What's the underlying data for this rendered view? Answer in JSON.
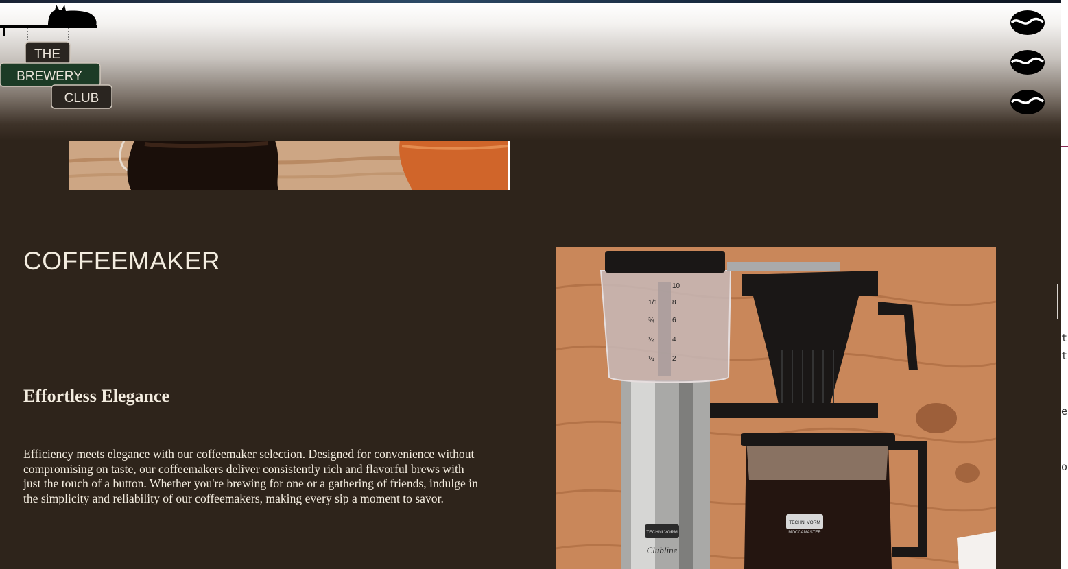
{
  "logo": {
    "line1": "THE",
    "line2": "BREWERY",
    "line3": "CLUB"
  },
  "nav": {
    "icons": [
      "coffee-bean-icon",
      "coffee-bean-icon",
      "coffee-bean-icon"
    ]
  },
  "section": {
    "title": "COFFEEMAKER",
    "subtitle": "Effortless Elegance",
    "description": "Efficiency meets elegance with our coffeemaker selection. Designed for convenience without compromising on taste, our coffeemakers deliver consistently rich and flavorful brews with just the touch of a button. Whether you're brewing for one or a gathering of friends, indulge in the simplicity and reliability of our coffeemakers, making every sip a moment to savor."
  },
  "product_image": {
    "brand_top": "TECHNI VORM",
    "brand_carafe": "TECHNI VORM",
    "model_script": "Clubline",
    "model_carafe": "MOCCAMASTER",
    "scale_left": [
      "1/1",
      "¾",
      "½",
      "¼"
    ],
    "scale_right": [
      "10",
      "8",
      "6",
      "4",
      "2"
    ]
  },
  "right_edge_chars": [
    "t",
    "t",
    "e",
    "o"
  ],
  "colors": {
    "background": "#2e241b",
    "text": "#f3ecdf",
    "logo_dark": "#2a2520",
    "logo_green": "#1c3b26"
  }
}
